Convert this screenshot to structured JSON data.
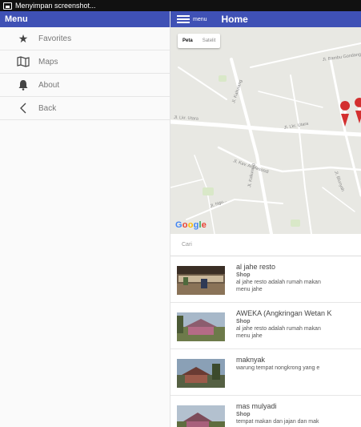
{
  "status_bar": {
    "text": "Menyimpan screenshot..."
  },
  "drawer": {
    "title": "Menu",
    "items": [
      {
        "label": "Favorites",
        "icon": "star-icon"
      },
      {
        "label": "Maps",
        "icon": "map-icon"
      },
      {
        "label": "About",
        "icon": "bell-icon"
      },
      {
        "label": "Back",
        "icon": "chevron-left-icon"
      }
    ]
  },
  "header": {
    "menu_label": "menu",
    "title": "Home"
  },
  "map": {
    "toggle": [
      "Peta",
      "Satelit"
    ],
    "road_labels": [
      "Jl. Lkr. Utara",
      "Jl. Lkr. Utara",
      "Jl. Kaliurang",
      "Jl. Kaliurang",
      "Jl. Kav. Al-Masoodi",
      "Jl. Ngu...",
      "Jl. Blunyah",
      "Jl. Bambu Gondang"
    ],
    "logo": "Google"
  },
  "search": {
    "placeholder": "Cari"
  },
  "places": [
    {
      "name": "al jahe resto",
      "type": "Shop",
      "desc1": "al jahe resto adalah rumah makan",
      "desc2": "menu jahe"
    },
    {
      "name": "AWEKA (Angkringan Wetan K",
      "type": "Shop",
      "desc1": "al jahe resto adalah rumah makan",
      "desc2": "menu jahe"
    },
    {
      "name": "maknyak",
      "type": "",
      "desc1": "warung tempat nongkrong yang e",
      "desc2": ""
    },
    {
      "name": "mas mulyadi",
      "type": "Shop",
      "desc1": "tempat makan dan jajan dan mak",
      "desc2": ""
    }
  ],
  "colors": {
    "primary": "#3f51b5",
    "marker": "#d32f2f"
  }
}
